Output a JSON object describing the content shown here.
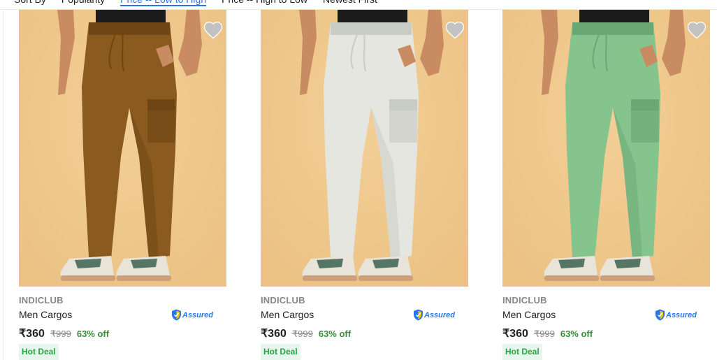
{
  "sort": {
    "label": "Sort By",
    "options": [
      "Popularity",
      "Price -- Low to High",
      "Price -- High to Low",
      "Newest First"
    ]
  },
  "products": [
    {
      "brand": "INDICLUB",
      "title": "Men Cargos",
      "assured_label": "Assured",
      "price": "₹360",
      "mrp": "₹999",
      "discount": "63% off",
      "badge": "Hot Deal",
      "pant_color": "#8a5a1e",
      "pant_shade": "#6e4614"
    },
    {
      "brand": "INDICLUB",
      "title": "Men Cargos",
      "assured_label": "Assured",
      "price": "₹360",
      "mrp": "₹999",
      "discount": "63% off",
      "badge": "Hot Deal",
      "pant_color": "#e4e6df",
      "pant_shade": "#c9ccc3"
    },
    {
      "brand": "INDICLUB",
      "title": "Men Cargos",
      "assured_label": "Assured",
      "price": "₹360",
      "mrp": "₹999",
      "discount": "63% off",
      "badge": "Hot Deal",
      "pant_color": "#86c48e",
      "pant_shade": "#6aa873"
    }
  ],
  "colors": {
    "accent": "#2874f0",
    "discount": "#388e3c",
    "badge_bg": "#e6f6ec",
    "badge_text": "#26a541",
    "image_bg": "#f0c98d"
  }
}
